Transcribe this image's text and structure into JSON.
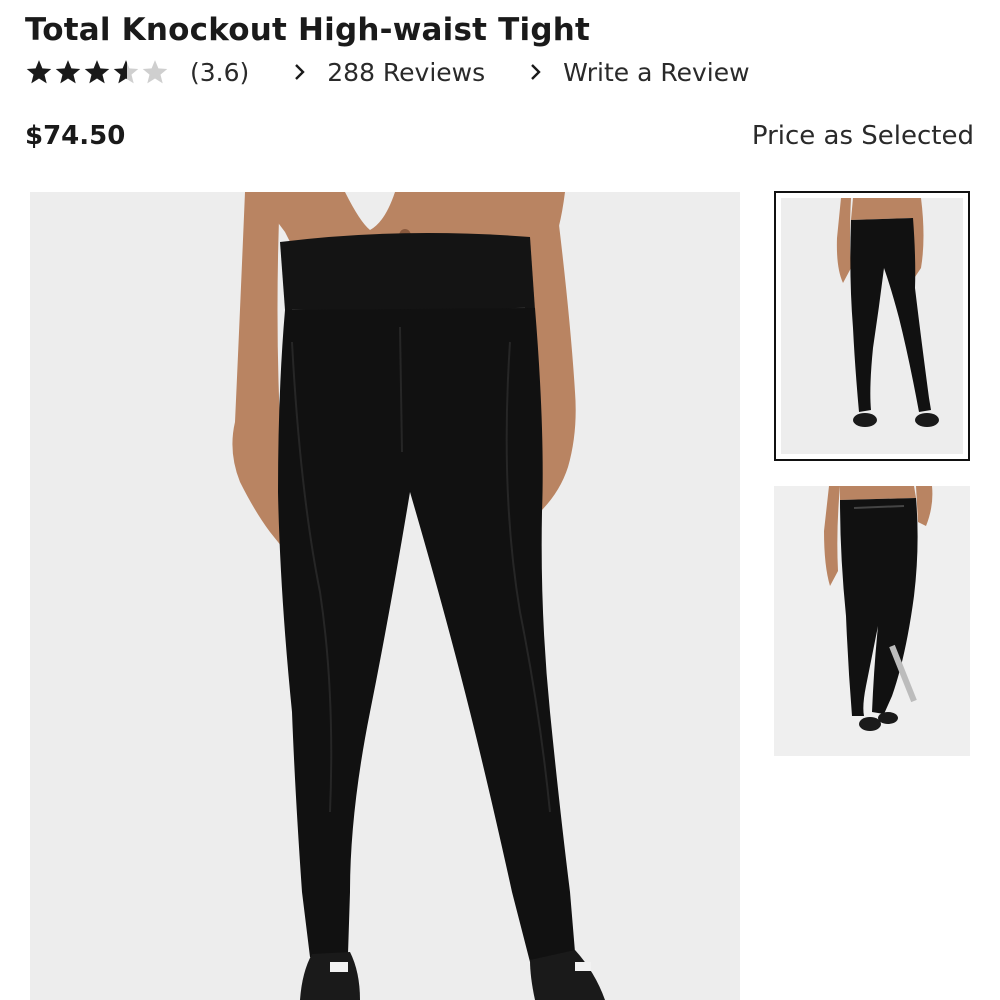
{
  "product": {
    "title": "Total Knockout High-waist Tight",
    "rating": {
      "value": 3.6,
      "display": "(3.6)",
      "stars_total": 5,
      "star_fills": [
        1,
        1,
        1,
        0.6,
        0
      ]
    },
    "reviews_link": "288 Reviews",
    "write_review_link": "Write a Review",
    "price": "$74.50",
    "price_note": "Price as Selected"
  },
  "gallery": {
    "main_image_alt": "Model wearing black high-waist leggings, front view",
    "thumbnails": [
      {
        "alt": "Front view full length",
        "selected": true
      },
      {
        "alt": "Back view with waistband",
        "selected": false
      }
    ]
  },
  "colors": {
    "text": "#1a1a1a",
    "star_filled": "#1a1a1a",
    "star_empty": "#cfcfcf",
    "image_bg": "#ededed",
    "legging": "#111111",
    "skin": "#b98462"
  }
}
